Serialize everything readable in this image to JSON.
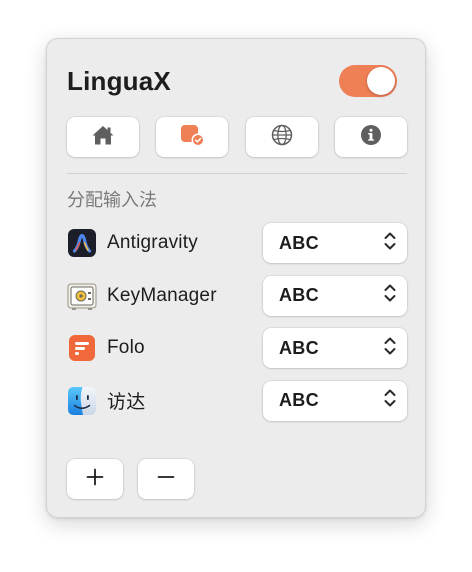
{
  "app": {
    "title": "LinguaX",
    "enabled": true
  },
  "colors": {
    "accent": "#ef7f55",
    "icon_gray": "#5f5f5f"
  },
  "toolbar": [
    {
      "icon": "home-icon"
    },
    {
      "icon": "app-assign-icon",
      "selected": true
    },
    {
      "icon": "globe-icon"
    },
    {
      "icon": "info-icon"
    }
  ],
  "section": {
    "title": "分配输入法"
  },
  "apps": [
    {
      "name": "Antigravity",
      "icon": "antigravity-app-icon",
      "input_method": "ABC"
    },
    {
      "name": "KeyManager",
      "icon": "keymanager-app-icon",
      "input_method": "ABC"
    },
    {
      "name": "Folo",
      "icon": "folo-app-icon",
      "input_method": "ABC"
    },
    {
      "name": "访达",
      "icon": "finder-app-icon",
      "input_method": "ABC"
    }
  ],
  "footer": {
    "add_label": "+",
    "remove_label": "−"
  }
}
